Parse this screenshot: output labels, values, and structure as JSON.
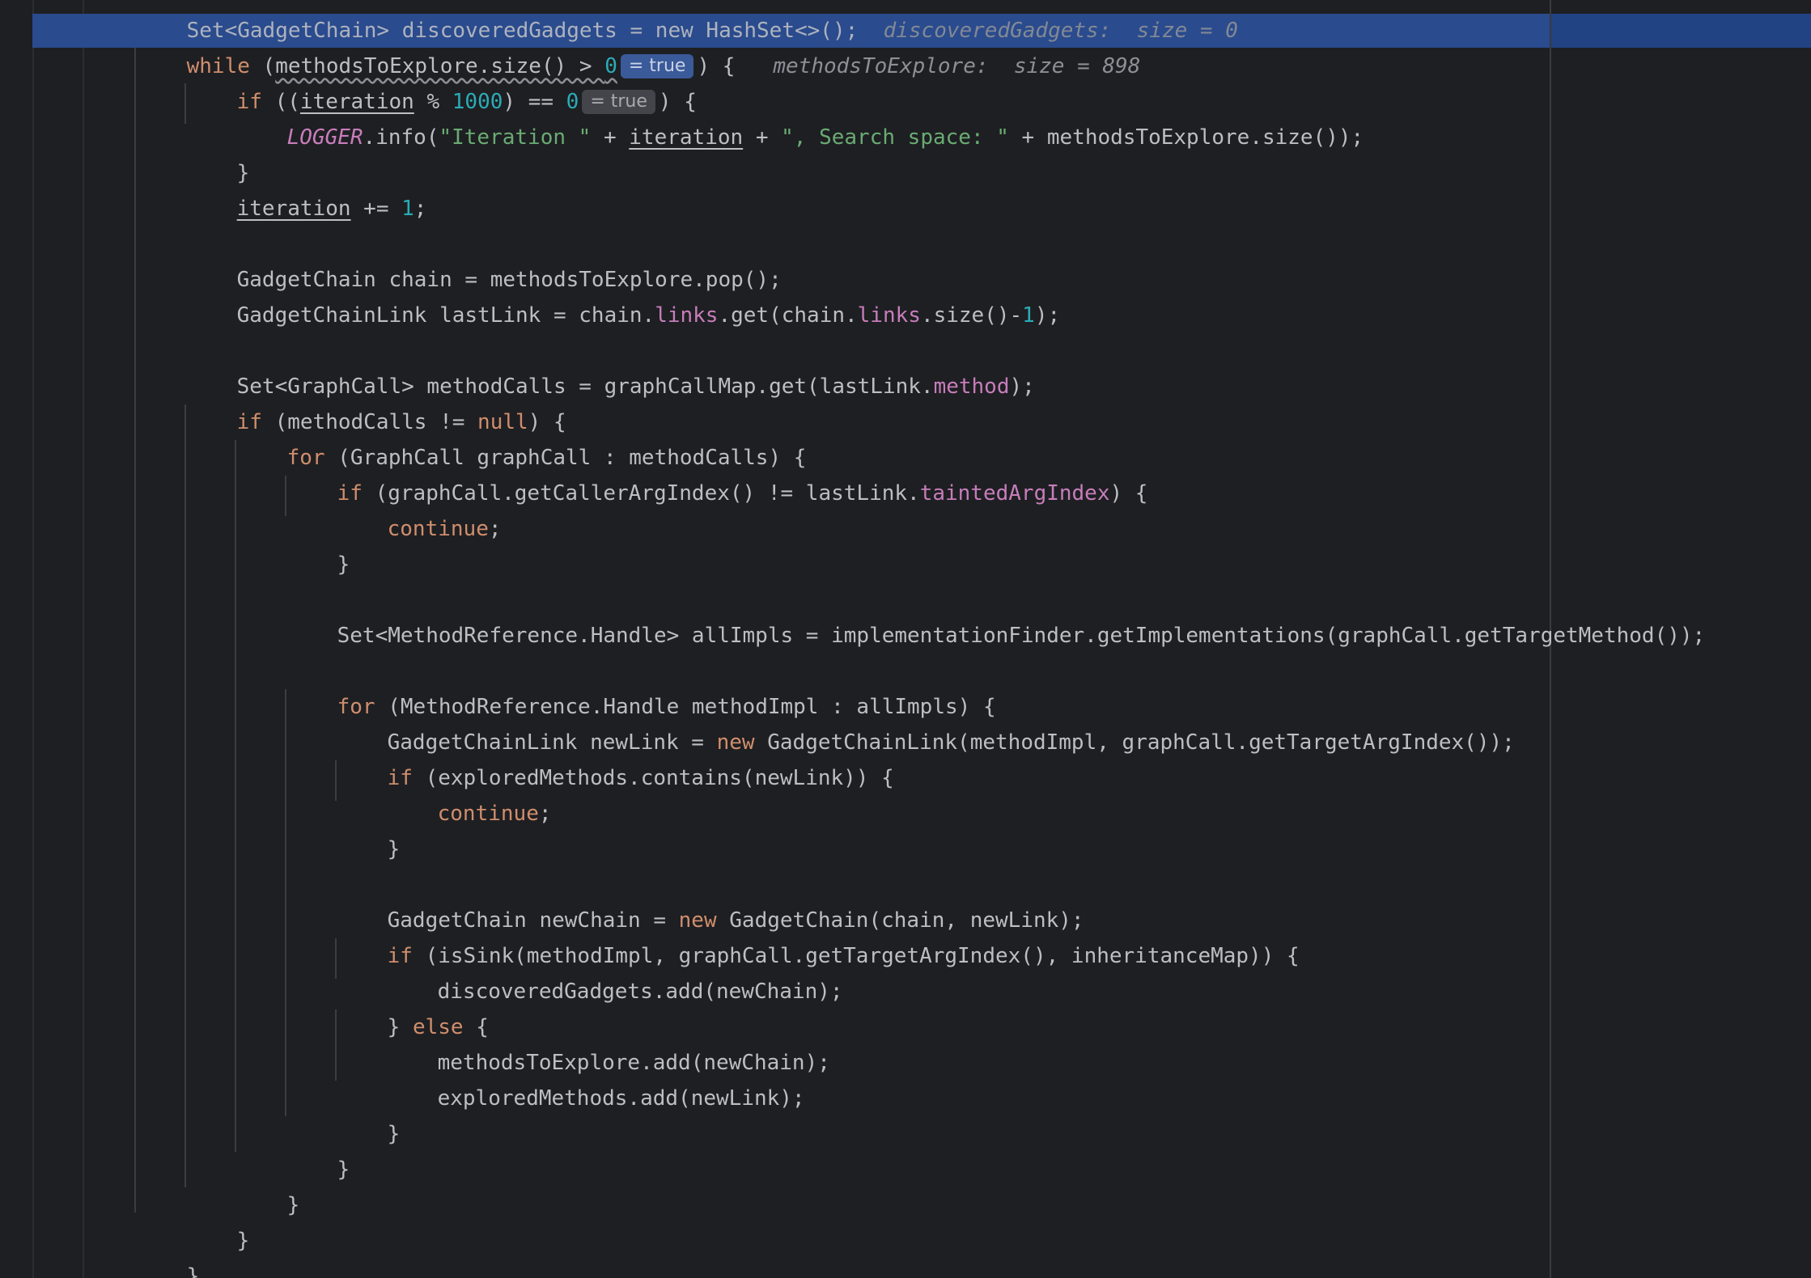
{
  "editor": {
    "colors": {
      "background": "#1e1f22",
      "execution_line": "#2a4b8d",
      "keyword": "#cf8e6d",
      "number": "#2aacb8",
      "string": "#6aab73",
      "field": "#c77dbb",
      "inline_hint": "#8c8f96",
      "text": "#bcbec4"
    },
    "top_partial_line": {
      "text": "Set<GadgetChain> discoveredGadgets = new HashSet<>();",
      "hint": "discoveredGadgets:  size = 0"
    },
    "execution_line": {
      "kw": "while",
      "pre": " (",
      "cond": "methodsToExplore.size() > ",
      "zero": "0",
      "badge": "= true",
      "post": ") {",
      "hint_label": "methodsToExplore:",
      "hint_value": "size = 898"
    },
    "line_if_iter": {
      "kw": "if",
      "a": " ((",
      "var": "iteration",
      "b": " % ",
      "num1": "1000",
      "c": ") == ",
      "num2": "0",
      "badge": "= true",
      "d": ") {"
    },
    "line_logger": {
      "cls": "LOGGER",
      "a": ".info(",
      "s1": "\"Iteration \"",
      "b": " + ",
      "var": "iteration",
      "c": " + ",
      "s2": "\", Search space: \"",
      "d": " + methodsToExplore.size());"
    },
    "line_close1": "}",
    "line_iter_inc": {
      "var": "iteration",
      "a": " += ",
      "num": "1",
      "b": ";"
    },
    "line_chain": "GadgetChain chain = methodsToExplore.pop();",
    "line_lastlink": {
      "a": "GadgetChainLink lastLink = chain.",
      "f1": "links",
      "b": ".get(chain.",
      "f2": "links",
      "c": ".size()-",
      "num": "1",
      "d": ");"
    },
    "line_methodcalls": {
      "a": "Set<GraphCall> methodCalls = graphCallMap.get(lastLink.",
      "f": "method",
      "b": ");"
    },
    "line_if_null": {
      "kw": "if",
      "a": " (methodCalls != ",
      "kw2": "null",
      "b": ") {"
    },
    "line_for_graphcall": {
      "kw": "for",
      "a": " (GraphCall graphCall : methodCalls) {"
    },
    "line_if_argindex": {
      "kw": "if",
      "a": " (graphCall.getCallerArgIndex() != lastLink.",
      "f": "taintedArgIndex",
      "b": ") {"
    },
    "line_continue1": {
      "kw": "continue",
      "a": ";"
    },
    "line_close2": "}",
    "line_allimpls": "Set<MethodReference.Handle> allImpls = implementationFinder.getImplementations(graphCall.getTargetMethod());",
    "line_for_impl": {
      "kw": "for",
      "a": " (MethodReference.Handle methodImpl : allImpls) {"
    },
    "line_newlink": {
      "a": "GadgetChainLink newLink = ",
      "kw": "new",
      "b": " GadgetChainLink(methodImpl, graphCall.getTargetArgIndex());"
    },
    "line_if_explored": {
      "kw": "if",
      "a": " (exploredMethods.contains(newLink)) {"
    },
    "line_continue2": {
      "kw": "continue",
      "a": ";"
    },
    "line_close3": "}",
    "line_newchain": {
      "a": "GadgetChain newChain = ",
      "kw": "new",
      "b": " GadgetChain(chain, newLink);"
    },
    "line_if_sink": {
      "kw": "if",
      "a": " (isSink(methodImpl, graphCall.getTargetArgIndex(), inheritanceMap)) {"
    },
    "line_add_gadget": "discoveredGadgets.add(newChain);",
    "line_else": {
      "a": "} ",
      "kw": "else",
      "b": " {"
    },
    "line_add_explore": "methodsToExplore.add(newChain);",
    "line_add_explored": "exploredMethods.add(newLink);",
    "line_close4": "}",
    "line_close5": "}",
    "line_close6": "}",
    "line_close7": "}",
    "line_close8": "}"
  }
}
